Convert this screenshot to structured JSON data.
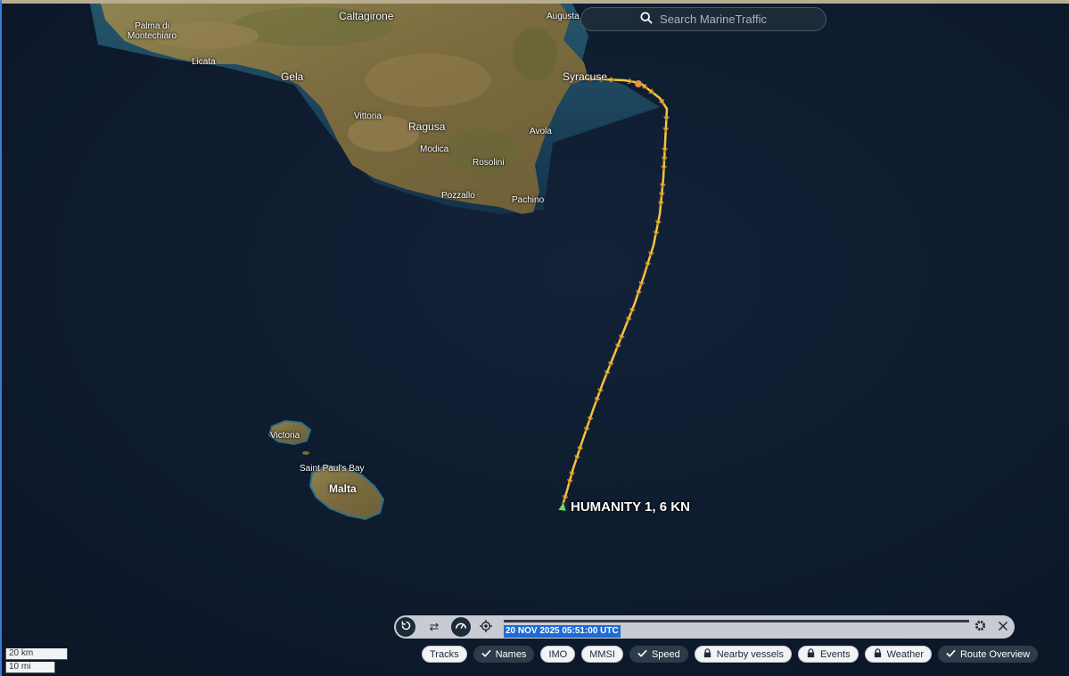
{
  "search": {
    "placeholder": "Search MarineTraffic"
  },
  "places": {
    "palma": "Palma di\nMontechiaro",
    "caltagirone": "Caltagirone",
    "augusta": "Augusta",
    "licata": "Licata",
    "gela": "Gela",
    "syracuse": "Syracuse",
    "vittoria": "Vittoria",
    "ragusa": "Ragusa",
    "avola": "Avola",
    "modica": "Modica",
    "rosolini": "Rosolini",
    "pozzallo": "Pozzallo",
    "pachino": "Pachino",
    "victoria": "Victoria",
    "saint_pauls_bay": "Saint Paul's Bay",
    "malta": "Malta"
  },
  "vessel": {
    "label": "HUMANITY 1, 6 KN"
  },
  "player": {
    "timestamp": "20 NOV 2025 05:51:00 UTC"
  },
  "toggles": {
    "tracks": "Tracks",
    "names": "Names",
    "imo": "IMO",
    "mmsi": "MMSI",
    "speed": "Speed",
    "nearby": "Nearby vessels",
    "events": "Events",
    "weather": "Weather",
    "route": "Route Overview"
  },
  "scale": {
    "km": "20 km",
    "mi": "10 mi"
  },
  "colors": {
    "track": "#f5c242",
    "sea": "#0f1c30",
    "land": "#8a7a4a",
    "highlight": "#1e6bd6"
  }
}
